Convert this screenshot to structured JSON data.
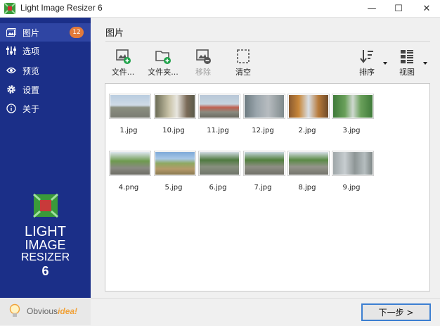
{
  "window": {
    "title": "Light Image Resizer 6",
    "minimize_glyph": "—",
    "maximize_glyph": "☐",
    "close_glyph": "✕"
  },
  "sidebar": {
    "items": [
      {
        "label": "图片",
        "icon": "pictures-icon",
        "badge": "12",
        "active": true
      },
      {
        "label": "选项",
        "icon": "sliders-icon"
      },
      {
        "label": "预览",
        "icon": "eye-icon"
      },
      {
        "label": "设置",
        "icon": "gear-icon"
      },
      {
        "label": "关于",
        "icon": "info-icon"
      }
    ],
    "logo": {
      "line1": "LIGHT",
      "line2": "IMAGE",
      "line3": "RESIZER",
      "line4": "6"
    },
    "brand": {
      "prefix": "Obvious",
      "suffix": "idea!"
    }
  },
  "main": {
    "title": "图片",
    "toolbar": [
      {
        "label": "文件...",
        "icon": "add-file-icon"
      },
      {
        "label": "文件夹...",
        "icon": "add-folder-icon"
      },
      {
        "label": "移除",
        "icon": "remove-image-icon",
        "disabled": true
      },
      {
        "label": "清空",
        "icon": "clear-icon"
      },
      {
        "label": "排序",
        "icon": "sort-icon"
      },
      {
        "label": "视图",
        "icon": "view-icon"
      }
    ],
    "thumbnails": [
      {
        "name": "1.jpg"
      },
      {
        "name": "10.jpg"
      },
      {
        "name": "11.jpg"
      },
      {
        "name": "12.jpg"
      },
      {
        "name": "2.jpg"
      },
      {
        "name": "3.jpg"
      },
      {
        "name": "4.png"
      },
      {
        "name": "5.jpg"
      },
      {
        "name": "6.jpg"
      },
      {
        "name": "7.jpg"
      },
      {
        "name": "8.jpg"
      },
      {
        "name": "9.jpg"
      }
    ]
  },
  "footer": {
    "next_label": "下一步 >"
  },
  "colors": {
    "sidebar": "#1b2f88",
    "badge": "#e27a3a",
    "accent": "#3c7fd1"
  }
}
